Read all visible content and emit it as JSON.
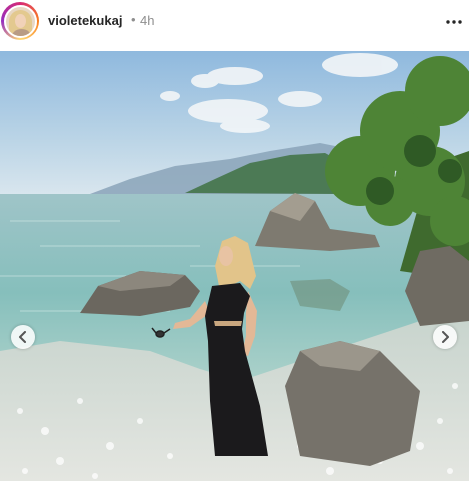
{
  "post": {
    "username": "violetekukaj",
    "separator": "•",
    "time_ago": "4h"
  },
  "icons": {
    "more": "more-horizontal-icon",
    "prev": "chevron-left-icon",
    "next": "chevron-right-icon"
  },
  "colors": {
    "username": "#262626",
    "secondary_text": "#8e8e8e",
    "story_ring": "#d62976"
  }
}
